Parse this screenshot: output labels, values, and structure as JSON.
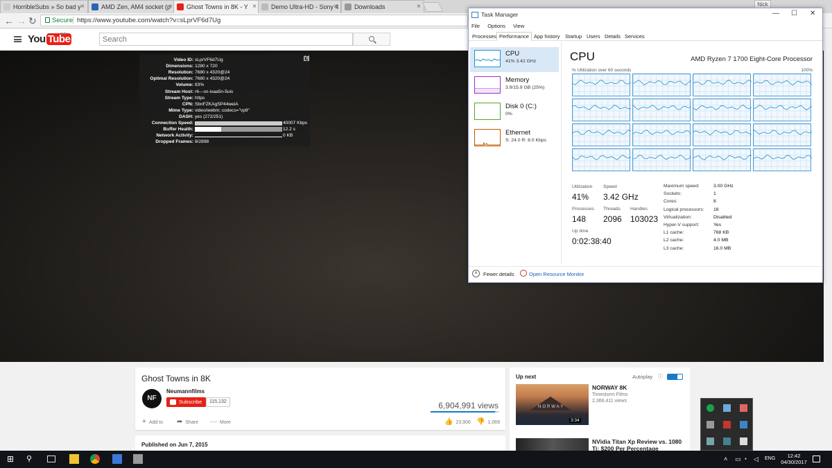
{
  "browser": {
    "tabs": [
      {
        "title": "HorribleSubs » So bad y",
        "active": false
      },
      {
        "title": "AMD Zen, AM4 socket (p",
        "active": false
      },
      {
        "title": "Ghost Towns in 8K - Y",
        "active": true
      },
      {
        "title": "Demo Ultra-HD - Sony 4",
        "active": false
      },
      {
        "title": "Downloads",
        "active": false
      }
    ],
    "user": "Nick",
    "secure_label": "Secure",
    "url": "https://www.youtube.com/watch?v=sLprVF6d7Ug"
  },
  "youtube": {
    "logo_you": "You",
    "logo_tube": "Tube",
    "region": "GR",
    "search_placeholder": "Search"
  },
  "stats": {
    "rows": [
      {
        "label": "Video ID:",
        "value": "sLprVF6d7Ug"
      },
      {
        "label": "Dimensions:",
        "value": "1280 x 720"
      },
      {
        "label": "Resolution:",
        "value": "7680 x 4320@24"
      },
      {
        "label": "Optimal Resolution:",
        "value": "7680 x 4320@24"
      },
      {
        "label": "Volume:",
        "value": "83%"
      },
      {
        "label": "Stream Host:",
        "value": "r6---sn-ixaa5n-5uis"
      },
      {
        "label": "Stream Type:",
        "value": "https"
      },
      {
        "label": "CPN:",
        "value": "SbnFZKAgSP44weiA"
      },
      {
        "label": "Mime Type:",
        "value": "video/webm; codecs=\"vp9\""
      },
      {
        "label": "DASH:",
        "value": "yes (272/251)"
      }
    ],
    "bars": [
      {
        "label": "Connection Speed:",
        "value": "40007 Kbps"
      },
      {
        "label": "Buffer Health:",
        "value": "12.2 s"
      },
      {
        "label": "Network Activity:",
        "value": "0 KB"
      }
    ],
    "dropped_label": "Dropped Frames:",
    "dropped_value": "8/2898",
    "close": "[x]"
  },
  "video": {
    "title": "Ghost Towns in 8K",
    "channel": "Neumannfilms",
    "avatar": "NF",
    "subscribe": "Subscribe",
    "subscribers": "115,132",
    "views": "6,904,991 views",
    "add_to": "Add to",
    "share": "Share",
    "more": "More",
    "likes": "23,906",
    "dislikes": "1,069",
    "published": "Published on Jun 7, 2015"
  },
  "upnext": {
    "title": "Up next",
    "autoplay": "Autoplay",
    "items": [
      {
        "title": "NORWAY 8K",
        "channel": "Timestorm Films",
        "views": "2,366,411 views",
        "duration": "3:34",
        "thumb_text": "NORWAY"
      },
      {
        "title": "NVidia Titan Xp Review vs. 1080 Ti: $200 Per Percentage"
      }
    ]
  },
  "taskmgr": {
    "title": "Task Manager",
    "menu": [
      "File",
      "Options",
      "View"
    ],
    "tabs": [
      "Processes",
      "Performance",
      "App history",
      "Startup",
      "Users",
      "Details",
      "Services"
    ],
    "active_tab": "Performance",
    "resources": [
      {
        "name": "CPU",
        "sub": "41% 3.42 GHz",
        "color": "#1e90d0"
      },
      {
        "name": "Memory",
        "sub": "3.9/15.9 GB (25%)",
        "color": "#9b30c8"
      },
      {
        "name": "Disk 0 (C:)",
        "sub": "0%",
        "color": "#4ea72e"
      },
      {
        "name": "Ethernet",
        "sub": "S: 24.0  R: 8.0 Kbps",
        "color": "#c05a00"
      }
    ],
    "cpu_heading": "CPU",
    "cpu_model": "AMD Ryzen 7 1700 Eight-Core Processor",
    "util_caption": "% Utilization over 60 seconds",
    "util_max": "100%",
    "stats": {
      "utilization_label": "Utilization",
      "utilization": "41%",
      "speed_label": "Speed",
      "speed": "3.42 GHz",
      "processes_label": "Processes",
      "processes": "148",
      "threads_label": "Threads",
      "threads": "2096",
      "handles_label": "Handles",
      "handles": "103023",
      "uptime_label": "Up time",
      "uptime": "0:02:38:40"
    },
    "specs": [
      {
        "label": "Maximum speed:",
        "value": "3.00 GHz"
      },
      {
        "label": "Sockets:",
        "value": "1"
      },
      {
        "label": "Cores:",
        "value": "8"
      },
      {
        "label": "Logical processors:",
        "value": "16"
      },
      {
        "label": "Virtualization:",
        "value": "Disabled"
      },
      {
        "label": "Hyper-V support:",
        "value": "Yes"
      },
      {
        "label": "L1 cache:",
        "value": "768 KB"
      },
      {
        "label": "L2 cache:",
        "value": "4.0 MB"
      },
      {
        "label": "L3 cache:",
        "value": "16.0 MB"
      }
    ],
    "fewer_details": "Fewer details",
    "open_rm": "Open Resource Monitor"
  },
  "taskbar": {
    "lang": "ENG",
    "time": "12:42",
    "date": "04/30/2017"
  },
  "colors": {
    "yt_red": "#e62117",
    "accent_blue": "#167ac6",
    "cpu_line": "#1e90d0"
  }
}
